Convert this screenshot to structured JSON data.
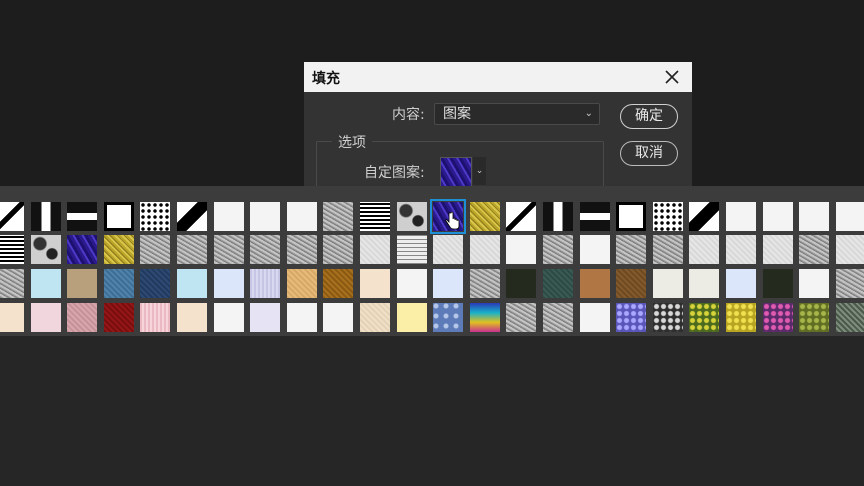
{
  "dialog": {
    "title": "填充",
    "content_label": "内容:",
    "content_value": "图案",
    "options_label": "选项",
    "custom_pattern_label": "自定图案:",
    "ok_label": "确定",
    "cancel_label": "取消"
  },
  "pattern_picker": {
    "selected_row": 0,
    "selected_col": 12,
    "rows": [
      [
        "diagonal-line",
        "vertical-bar",
        "horizontal-bar",
        "white-square-black-border",
        "polka-dots",
        "diagonal-steps",
        "white",
        "white",
        "white",
        "gray-noise",
        "concentric-squares",
        "camouflage",
        "blue-purple-waves",
        "yellow-noise",
        "diagonal-line",
        "vertical-bar",
        "horizontal-bar",
        "white-square-black-border",
        "polka-dots",
        "diagonal-steps",
        "white",
        "white",
        "white",
        "white"
      ],
      [
        "concentric-squares",
        "camouflage",
        "blue-purple-waves",
        "yellow-noise",
        "gray-noise",
        "gray-noise",
        "gray-noise",
        "gray-noise",
        "gray-noise",
        "gray-noise",
        "light-gray",
        "crosshatch",
        "light-gray",
        "light-gray",
        "white",
        "gray-noise",
        "white",
        "gray-noise",
        "gray-noise",
        "light-gray",
        "light-gray",
        "light-gray",
        "gray-noise",
        "light-gray"
      ],
      [
        "gray-noise",
        "light-blue",
        "tan",
        "steel-blue",
        "navy",
        "light-blue",
        "pale-blue",
        "lilac",
        "orange-tan",
        "brown-gold",
        "pale-peach",
        "white",
        "pale-blue",
        "gray-noise",
        "dark-olive",
        "dark-teal",
        "copper",
        "brown",
        "off-white",
        "off-white",
        "pale-blue",
        "dark-olive",
        "white",
        "gray-noise"
      ],
      [
        "pale-peach",
        "pale-pink",
        "dusty-pink",
        "dark-red",
        "pink-stripes",
        "pale-peach",
        "white",
        "lavender",
        "white",
        "white",
        "sand",
        "pale-yellow",
        "blue-bubbles",
        "rainbow",
        "gray-noise",
        "gray-noise",
        "white",
        "blue-purple-flowers",
        "black-multi",
        "green-yellow-floral",
        "yellow-floral",
        "purple-floral",
        "olive-floral",
        "green-gray"
      ]
    ]
  }
}
